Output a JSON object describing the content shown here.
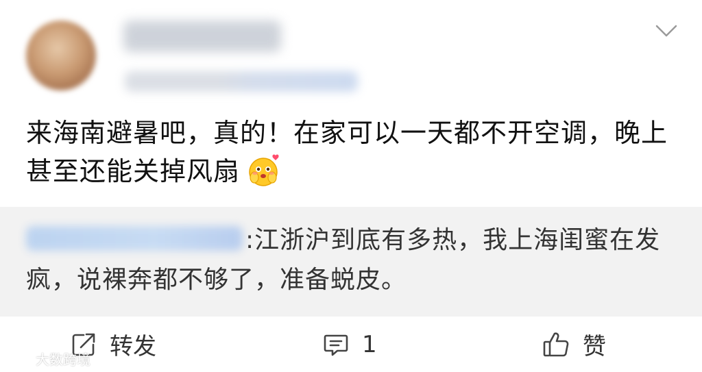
{
  "post": {
    "text": "来海南避暑吧，真的！在家可以一天都不开空调，晚上甚至还能关掉风扇"
  },
  "quote": {
    "text": ":江浙沪到底有多热，我上海闺蜜在发疯，说裸奔都不够了，准备蜕皮。"
  },
  "actions": {
    "repost_label": "转发",
    "comment_count": "1",
    "like_label": "赞"
  },
  "watermark": {
    "text": "大数跨境"
  },
  "icons": {
    "chevron": "chevron-down-icon",
    "emoji": "blushing-face-emoji-icon",
    "repost": "repost-icon",
    "comment": "comment-icon",
    "like": "thumbs-up-icon"
  }
}
